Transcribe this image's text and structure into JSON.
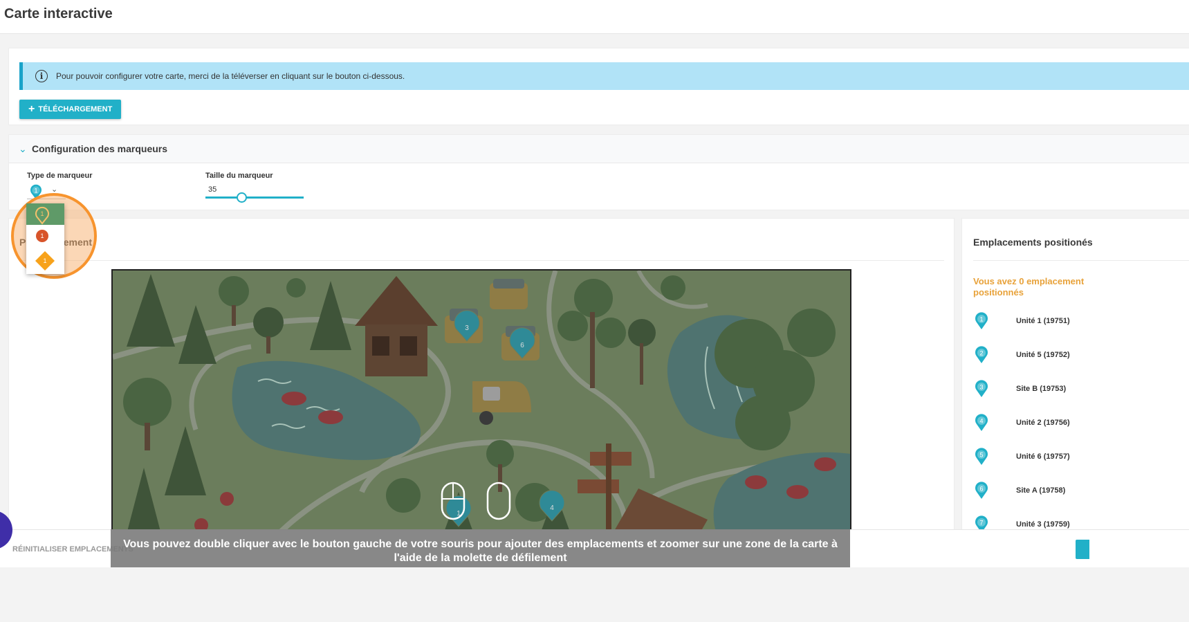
{
  "page": {
    "title": "Carte interactive"
  },
  "upload": {
    "alert_text": "Pour pouvoir configurer votre carte, merci de la téléverser en cliquant sur le bouton ci-dessous.",
    "button_label": "TÉLÉCHARGEMENT",
    "button_icon": "plus-icon"
  },
  "marker_config": {
    "title": "Configuration des marqueurs",
    "type_label": "Type de marqueur",
    "selected_type": "1",
    "size_label": "Taille du marqueur",
    "size_value": "35",
    "options": [
      {
        "glyph": "1",
        "shape": "pin-outline",
        "color": "#f4c06b"
      },
      {
        "glyph": "1",
        "shape": "circle",
        "color": "#d8542a"
      },
      {
        "glyph": "1",
        "shape": "diamond",
        "color": "#f7a21b"
      }
    ]
  },
  "placement": {
    "title": "Positionnement",
    "map_markers": [
      {
        "label": "3"
      },
      {
        "label": "6"
      },
      {
        "label": "1"
      },
      {
        "label": "4"
      }
    ],
    "hint": "Vous pouvez double cliquer avec le bouton gauche de votre souris pour ajouter des emplacements et zoomer sur une zone de la carte à l'aide de la molette de défilement"
  },
  "locations": {
    "title": "Emplacements positionés",
    "count_text": "Vous avez 0 emplacement positionnés",
    "items": [
      {
        "num": "1",
        "name": "Unité 1 (19751)"
      },
      {
        "num": "2",
        "name": "Unité 5 (19752)"
      },
      {
        "num": "3",
        "name": "Site B (19753)"
      },
      {
        "num": "4",
        "name": "Unité 2 (19756)"
      },
      {
        "num": "5",
        "name": "Unité 6 (19757)"
      },
      {
        "num": "6",
        "name": "Site A (19758)"
      },
      {
        "num": "7",
        "name": "Unité 3 (19759)"
      }
    ]
  },
  "footer": {
    "reset_label": "RÉINITIALISER EMPLACEMENTS"
  },
  "colors": {
    "accent": "#21b0c8",
    "alert_bg": "#b1e3f7",
    "highlight": "#f7942e",
    "count_text": "#e8a23a"
  }
}
